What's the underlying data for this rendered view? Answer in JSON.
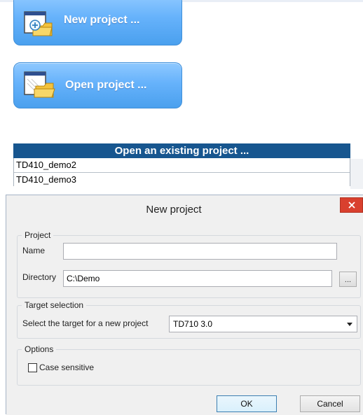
{
  "launcher": {
    "new_project_label": "New project ...",
    "open_project_label": "Open project ...",
    "existing_header": "Open an existing project ...",
    "existing_projects": [
      "TD410_demo2",
      "TD410_demo3"
    ]
  },
  "dialog": {
    "title": "New project",
    "close_icon": "close-icon",
    "project_group": {
      "label": "Project",
      "name_label": "Name",
      "name_value": "",
      "directory_label": "Directory",
      "directory_value": "C:\\Demo",
      "browse_label": "..."
    },
    "target_group": {
      "label": "Target selection",
      "select_label": "Select the target for a new project",
      "selected_target": "TD710 3.0"
    },
    "options_group": {
      "label": "Options",
      "case_sensitive_label": "Case sensitive",
      "case_sensitive_checked": false
    },
    "ok_label": "OK",
    "cancel_label": "Cancel"
  },
  "colors": {
    "button_blue": "#66b2fb",
    "header_navy": "#17568f",
    "close_red": "#d9402e"
  }
}
